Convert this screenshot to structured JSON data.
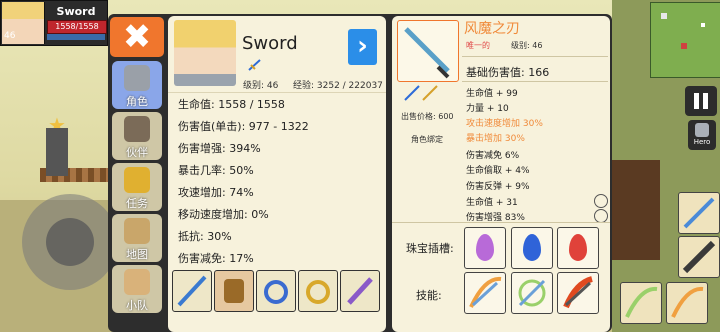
{
  "hud": {
    "name": "Sword",
    "hp": "1558/1558",
    "level": "46"
  },
  "close_symbol": "✖",
  "tabs": [
    {
      "label": "角色",
      "icon": "helmet-icon",
      "active": true
    },
    {
      "label": "伙伴",
      "icon": "viking-helmet-icon",
      "active": false
    },
    {
      "label": "任务",
      "icon": "trophy-icon",
      "active": false
    },
    {
      "label": "地图",
      "icon": "scroll-map-icon",
      "active": false
    },
    {
      "label": "小队",
      "icon": "party-icon",
      "active": false
    }
  ],
  "character": {
    "name": "Sword",
    "next_symbol": "›",
    "level": "级别: 46",
    "exp": "经验: 3252 / 222037",
    "stats": [
      "生命值: 1558 / 1558",
      "伤害值(单击): 977 - 1322",
      "伤害增强: 394%",
      "暴击几率: 50%",
      "攻速增加: 74%",
      "移动速度增加: 0%",
      "抵抗: 30%",
      "伤害减免: 17%"
    ],
    "equipment": [
      "sword-icon",
      "armor-icon",
      "ring-icon",
      "gold-ring-icon",
      "feather-icon"
    ]
  },
  "item": {
    "name": "风魔之刃",
    "rarity": "唯一的",
    "level": "级别: 46",
    "base_damage": "基础伤害值: 166",
    "price": "出售价格: 600",
    "bind": "角色绑定",
    "affixes": [
      {
        "text": "生命值 + 99",
        "color": "#222222"
      },
      {
        "text": "力量 + 10",
        "color": "#222222"
      },
      {
        "text": "攻击速度增加 30%",
        "color": "#f08a3a"
      },
      {
        "text": "暴击增加 30%",
        "color": "#f08a3a"
      },
      {
        "text": "伤害减免 6%",
        "color": "#222222"
      },
      {
        "text": "生命偷取 + 4%",
        "color": "#222222"
      },
      {
        "text": "伤害反弹 + 9%",
        "color": "#222222"
      },
      {
        "text": "生命值 + 31",
        "color": "#222222"
      },
      {
        "text": "伤害增强 83%",
        "color": "#222222"
      }
    ],
    "gem_label": "珠宝插槽:",
    "gems": [
      {
        "icon": "purple-gem-icon",
        "color": "#b86ad8"
      },
      {
        "icon": "blue-gem-icon",
        "color": "#2f63d8"
      },
      {
        "icon": "red-gem-icon",
        "color": "#e0423a"
      }
    ],
    "skill_label": "技能:",
    "skills": [
      "slash-skill-icon",
      "wind-blade-skill-icon",
      "fire-slash-skill-icon"
    ]
  },
  "hero_button": "Hero",
  "colors": {
    "accent": "#f0762d",
    "tab_active": "#8aa6e9",
    "next_button": "#2b8ee8",
    "unique_text": "#f08a3a"
  }
}
